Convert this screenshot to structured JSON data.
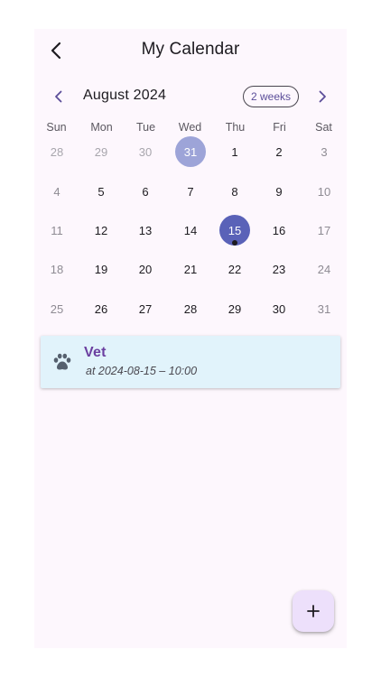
{
  "app_bar": {
    "title": "My Calendar"
  },
  "calendar": {
    "month_label": "August 2024",
    "format_button": "2 weeks",
    "weekdays": [
      "Sun",
      "Mon",
      "Tue",
      "Wed",
      "Thu",
      "Fri",
      "Sat"
    ],
    "weeks": [
      [
        "28",
        "29",
        "30",
        "31",
        "1",
        "2",
        "3"
      ],
      [
        "4",
        "5",
        "6",
        "7",
        "8",
        "9",
        "10"
      ],
      [
        "11",
        "12",
        "13",
        "14",
        "15",
        "16",
        "17"
      ],
      [
        "18",
        "19",
        "20",
        "21",
        "22",
        "23",
        "24"
      ],
      [
        "25",
        "26",
        "27",
        "28",
        "29",
        "30",
        "31"
      ]
    ],
    "today": "31",
    "selected": "15"
  },
  "event": {
    "title": "Vet",
    "subtitle": "at 2024-08-15 – 10:00",
    "icon": "paw-icon"
  },
  "fab": {
    "icon": "plus-icon"
  },
  "colors": {
    "accent": "#5a62b8",
    "today": "#9da4d8",
    "event_bg": "#e1f3fb",
    "event_title": "#6b3fa0",
    "fab_bg": "#ede0fb"
  }
}
